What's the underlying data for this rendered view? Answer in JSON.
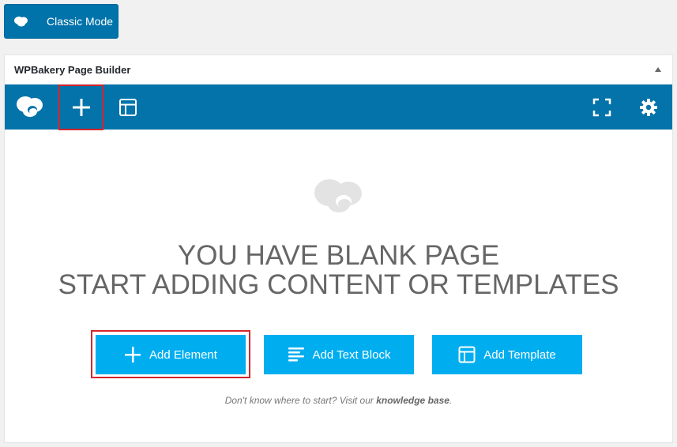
{
  "classic_mode": {
    "label": "Classic Mode",
    "icon": "cloud-icon"
  },
  "panel": {
    "title": "WPBakery Page Builder",
    "toggle_icon": "triangle-up-icon"
  },
  "navbar": {
    "background": "#0473aa",
    "logo_icon": "wpbakery-cloud-logo-icon",
    "add_icon": "plus-icon",
    "templates_icon": "layout-template-icon",
    "fullscreen_icon": "fullscreen-icon",
    "settings_icon": "gear-icon"
  },
  "content": {
    "logo_icon": "cloud-logo-icon",
    "headline_line1": "YOU HAVE BLANK PAGE",
    "headline_line2": "START ADDING CONTENT OR TEMPLATES",
    "buttons": [
      {
        "label": "Add Element",
        "icon": "plus-icon"
      },
      {
        "label": "Add Text Block",
        "icon": "text-lines-icon"
      },
      {
        "label": "Add Template",
        "icon": "layout-template-icon"
      }
    ],
    "hint_prefix": "Don't know where to start? Visit our",
    "hint_link": "knowledge base",
    "hint_suffix": "."
  },
  "colors": {
    "accent_blue": "#0473aa",
    "button_blue": "#00aef0",
    "highlight_red": "#d5252c"
  }
}
